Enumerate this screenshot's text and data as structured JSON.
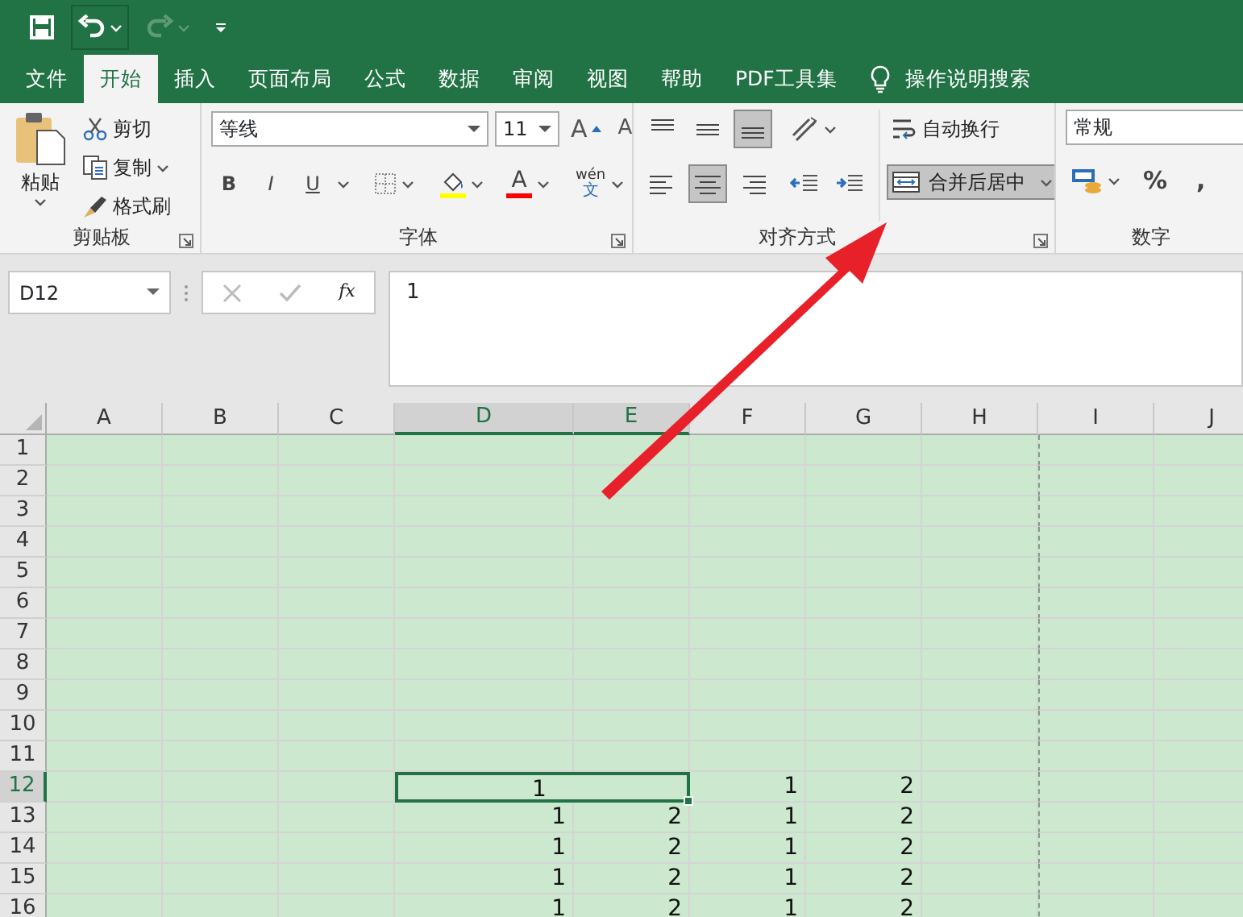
{
  "quick_access": [
    {
      "kind": "save",
      "disabled": false
    },
    {
      "kind": "undo",
      "disabled": false
    },
    {
      "kind": "redo",
      "disabled": true
    },
    {
      "kind": "customize",
      "disabled": false
    }
  ],
  "tabs": [
    {
      "label": "文件",
      "selected": false
    },
    {
      "label": "开始",
      "selected": true
    },
    {
      "label": "插入",
      "selected": false
    },
    {
      "label": "页面布局",
      "selected": false
    },
    {
      "label": "公式",
      "selected": false
    },
    {
      "label": "数据",
      "selected": false
    },
    {
      "label": "审阅",
      "selected": false
    },
    {
      "label": "视图",
      "selected": false
    },
    {
      "label": "帮助",
      "selected": false
    },
    {
      "label": "PDF工具集",
      "selected": false
    }
  ],
  "tell_me": {
    "label": "操作说明搜索"
  },
  "ribbon": {
    "groups": [
      {
        "kind": "clipboard",
        "label": "剪贴板",
        "paste": "粘贴",
        "cut": "剪切",
        "copy": "复制",
        "format_painter": "格式刷"
      },
      {
        "kind": "font",
        "label": "字体",
        "font": "等线",
        "size": "11",
        "size_buttons": [
          "A",
          "A"
        ],
        "style_buttons": [
          "B",
          "I",
          "U"
        ],
        "font_color_glyph": "A",
        "phonetic": [
          "wén",
          "文"
        ]
      },
      {
        "kind": "alignment",
        "label": "对齐方式",
        "vertical": [
          {
            "kind": "top",
            "selected": false
          },
          {
            "kind": "middle",
            "selected": false
          },
          {
            "kind": "bottom",
            "selected": true
          }
        ],
        "horizontal": [
          {
            "kind": "left",
            "selected": false
          },
          {
            "kind": "center",
            "selected": true
          },
          {
            "kind": "right",
            "selected": false
          }
        ],
        "wrap": "自动换行",
        "merge": {
          "label": "合并后居中",
          "selected": true
        }
      },
      {
        "kind": "number",
        "label": "数字",
        "format": "常规",
        "buttons": [
          "%",
          ","
        ]
      }
    ]
  },
  "formula_bar": {
    "name_box": "D12",
    "function_label": "fx",
    "formula": "1"
  },
  "sheet": {
    "columns": [
      {
        "label": "A",
        "selected": false,
        "page_break": false
      },
      {
        "label": "B",
        "selected": false,
        "page_break": false
      },
      {
        "label": "C",
        "selected": false,
        "page_break": false
      },
      {
        "label": "D",
        "selected": true,
        "page_break": false
      },
      {
        "label": "E",
        "selected": true,
        "page_break": false
      },
      {
        "label": "F",
        "selected": false,
        "page_break": false
      },
      {
        "label": "G",
        "selected": false,
        "page_break": false
      },
      {
        "label": "H",
        "selected": false,
        "page_break": false
      },
      {
        "label": "I",
        "selected": false,
        "page_break": true
      },
      {
        "label": "J",
        "selected": false,
        "page_break": false
      }
    ],
    "rows": [
      {
        "header": "1",
        "selected": false
      },
      {
        "header": "2",
        "selected": false
      },
      {
        "header": "3",
        "selected": false
      },
      {
        "header": "4",
        "selected": false
      },
      {
        "header": "5",
        "selected": false
      },
      {
        "header": "6",
        "selected": false
      },
      {
        "header": "7",
        "selected": false
      },
      {
        "header": "8",
        "selected": false
      },
      {
        "header": "9",
        "selected": false
      },
      {
        "header": "10",
        "selected": false
      },
      {
        "header": "11",
        "selected": false
      },
      {
        "header": "12",
        "selected": true,
        "cells": [
          null,
          null,
          null,
          {
            "value": "1",
            "merged": true,
            "selected": true
          },
          null,
          "1",
          "2",
          null,
          null,
          null
        ]
      },
      {
        "header": "13",
        "selected": false,
        "cells": [
          null,
          null,
          null,
          "1",
          "2",
          "1",
          "2",
          null,
          null,
          null
        ]
      },
      {
        "header": "14",
        "selected": false,
        "cells": [
          null,
          null,
          null,
          "1",
          "2",
          "1",
          "2",
          null,
          null,
          null
        ]
      },
      {
        "header": "15",
        "selected": false,
        "cells": [
          null,
          null,
          null,
          "1",
          "2",
          "1",
          "2",
          null,
          null,
          null
        ]
      },
      {
        "header": "16",
        "selected": false,
        "cells": [
          null,
          null,
          null,
          "1",
          "2",
          "1",
          "2",
          null,
          null,
          null
        ]
      }
    ]
  }
}
